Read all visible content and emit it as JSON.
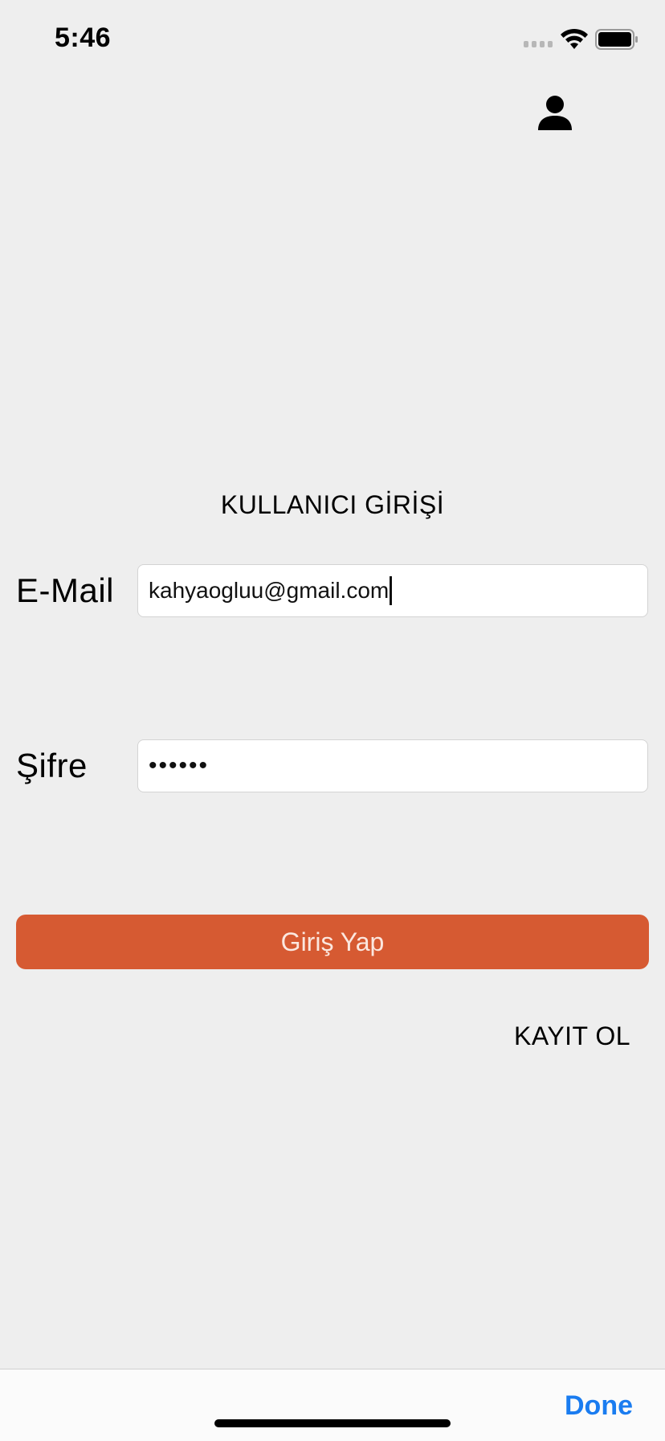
{
  "status_bar": {
    "time": "5:46",
    "wifi_icon": "wifi-icon",
    "battery_icon": "battery-icon",
    "signal_icon": "signal-dots-icon"
  },
  "header": {
    "profile_icon": "person-icon"
  },
  "form": {
    "title": "KULLANICI GİRİŞİ",
    "email": {
      "label": "E-Mail",
      "value": "kahyaogluu@gmail.com"
    },
    "password": {
      "label": "Şifre",
      "value": "••••••"
    },
    "login_button": {
      "label": "Giriş Yap",
      "color": "#d65a32"
    },
    "register_link": "KAYIT OL"
  },
  "accessory_bar": {
    "done_label": "Done",
    "done_color": "#1a7cf0"
  }
}
